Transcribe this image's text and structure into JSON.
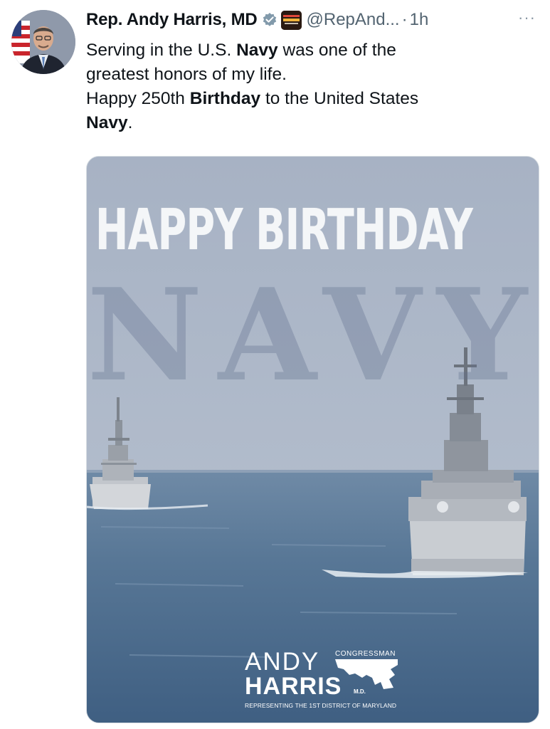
{
  "post": {
    "author": {
      "display_name": "Rep. Andy Harris, MD",
      "handle": "@RepAnd...",
      "time_ago": "1h",
      "verified_icon": "verified-badge-icon",
      "affiliation_icon": "affiliation-badge-icon"
    },
    "more_label": "···",
    "dot": "·",
    "text": {
      "line1_before": "Serving in the U.S. ",
      "line1_bold": "Navy",
      "line1_after": " was one of the",
      "line2": "greatest honors of my life.",
      "line3_before": "Happy 250th ",
      "line3_bold": "Birthday",
      "line3_after": " to the United States",
      "line4_bold": "Navy",
      "line4_after": "."
    },
    "media": {
      "headline": "HAPPY BIRTHDAY",
      "watermark": "NAVY",
      "logo": {
        "first_name": "ANDY",
        "title": "CONGRESSMAN",
        "last_name": "HARRIS",
        "suffix": "M.D.",
        "tagline": "REPRESENTING THE 1ST DISTRICT OF MARYLAND"
      }
    }
  },
  "colors": {
    "text_primary": "#0f1419",
    "text_secondary": "#536471",
    "verified_blue": "#829aab",
    "sky": "#a9b4c6",
    "sea": "#4f6e8f"
  }
}
